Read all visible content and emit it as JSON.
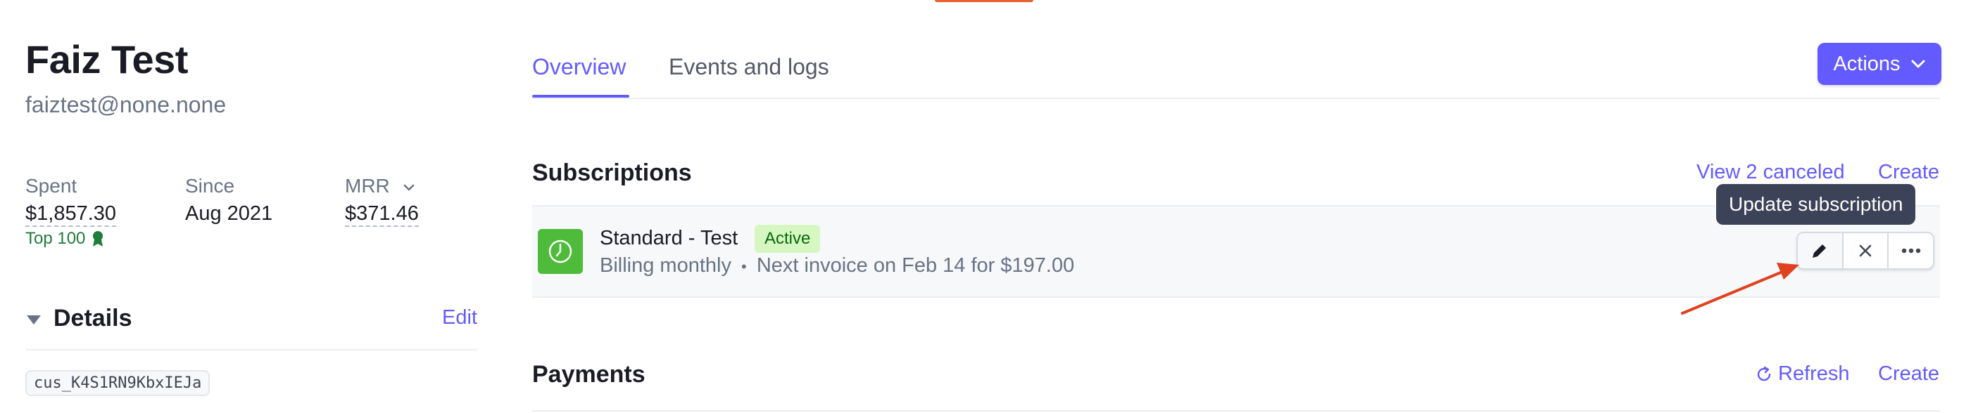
{
  "customer": {
    "name": "Faiz Test",
    "email": "faiztest@none.none",
    "stats": {
      "spent_label": "Spent",
      "spent_value": "$1,857.30",
      "top_badge": "Top 100",
      "since_label": "Since",
      "since_value": "Aug 2021",
      "mrr_label": "MRR",
      "mrr_value": "$371.46"
    },
    "details": {
      "title": "Details",
      "edit_label": "Edit",
      "customer_id": "cus_K4S1RN9KbxIEJa"
    }
  },
  "tabs": [
    {
      "label": "Overview",
      "active": true
    },
    {
      "label": "Events and logs",
      "active": false
    }
  ],
  "actions_label": "Actions",
  "subscriptions": {
    "title": "Subscriptions",
    "view_canceled_label": "View 2 canceled",
    "create_label": "Create",
    "items": [
      {
        "name": "Standard - Test",
        "status": "Active",
        "billing": "Billing monthly",
        "separator": "•",
        "next_invoice": "Next invoice on Feb 14 for $197.00"
      }
    ],
    "tooltip": "Update subscription"
  },
  "payments": {
    "title": "Payments",
    "refresh_label": "Refresh",
    "create_label": "Create"
  },
  "colors": {
    "accent": "#635bff",
    "active_badge_bg": "#d7f7c2",
    "active_badge_text": "#05690d",
    "product_icon": "#4fbb3a",
    "annotation_arrow": "#e0411e"
  },
  "icons": {
    "mrr_dropdown": "chevron-down-icon",
    "top_badge": "award-ribbon-icon",
    "details_toggle": "caret-down-icon",
    "actions_dropdown": "chevron-down-icon",
    "product": "clock-icon",
    "edit": "pencil-icon",
    "cancel": "close-icon",
    "more": "more-horizontal-icon",
    "refresh": "refresh-icon"
  }
}
